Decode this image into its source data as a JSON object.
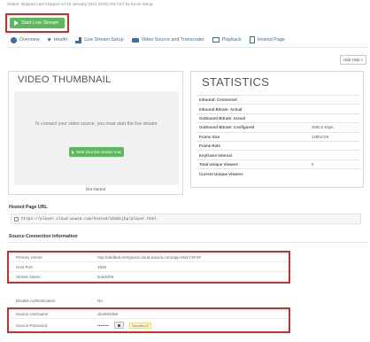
{
  "header": {
    "status_line": "Status: stopped   Last stopped on 16 January 2021 10:02 AM CST by Kevin Wang",
    "start_button": "Start Live Stream"
  },
  "tabs": [
    {
      "label": "Overview",
      "icon": "overview-icon"
    },
    {
      "label": "Health",
      "icon": "heart-icon"
    },
    {
      "label": "Live Stream Setup",
      "icon": "chart-icon"
    },
    {
      "label": "Video Source and Transcoder",
      "icon": "camera-icon"
    },
    {
      "label": "Playback",
      "icon": "monitor-icon"
    },
    {
      "label": "Hosted Page",
      "icon": "page-icon"
    }
  ],
  "help_button": "Hide Help »",
  "thumbnail": {
    "title": "VIDEO THUMBNAIL",
    "message": "To connect your video source, you must start the live stream.",
    "button": "Start your live stream now",
    "status": "Not started"
  },
  "statistics": {
    "title": "STATISTICS",
    "rows": [
      {
        "label": "Inbound: Connected",
        "value": ""
      },
      {
        "label": "Inbound Bitrate: Actual",
        "value": ""
      },
      {
        "label": "Outbound Bitrate: Actual",
        "value": ""
      },
      {
        "label": "Outbound Bitrate: Configured",
        "value": "3000.0 Kbps"
      },
      {
        "label": "Frame Size",
        "value": "1280x720"
      },
      {
        "label": "Frame Rate",
        "value": ""
      },
      {
        "label": "Keyframe Interval",
        "value": ""
      },
      {
        "label": "Total Unique Viewers",
        "value": "0"
      },
      {
        "label": "Current Unique Viewers",
        "value": ""
      }
    ]
  },
  "hosted_page": {
    "title": "Hosted Page URL",
    "url": "https://player.cloud.wowza.com/hosted/1k6dcjkp/player.html"
  },
  "source_connection": {
    "title": "Source Connection Information",
    "primary_server_label": "Primary Server",
    "primary_server_value": "rtsp://ded5ed.entrypoint.cloud.wowza.com/app-5M1YXFSF",
    "host_port_label": "Host Port",
    "host_port_value": "1935",
    "stream_name_label": "Stream Name",
    "stream_name_value": "5c6dcf06",
    "disable_auth_label": "Disable Authentication",
    "disable_auth_value": "No",
    "username_label": "Source Username",
    "username_value": "client63398",
    "password_label": "Source Password",
    "password_dots": "•••••••",
    "password_reveal": "f3bcdbb22"
  },
  "colors": {
    "accent_green": "#5cb85c",
    "highlight_red": "#c9302c",
    "link_blue": "#3a6ea5"
  }
}
